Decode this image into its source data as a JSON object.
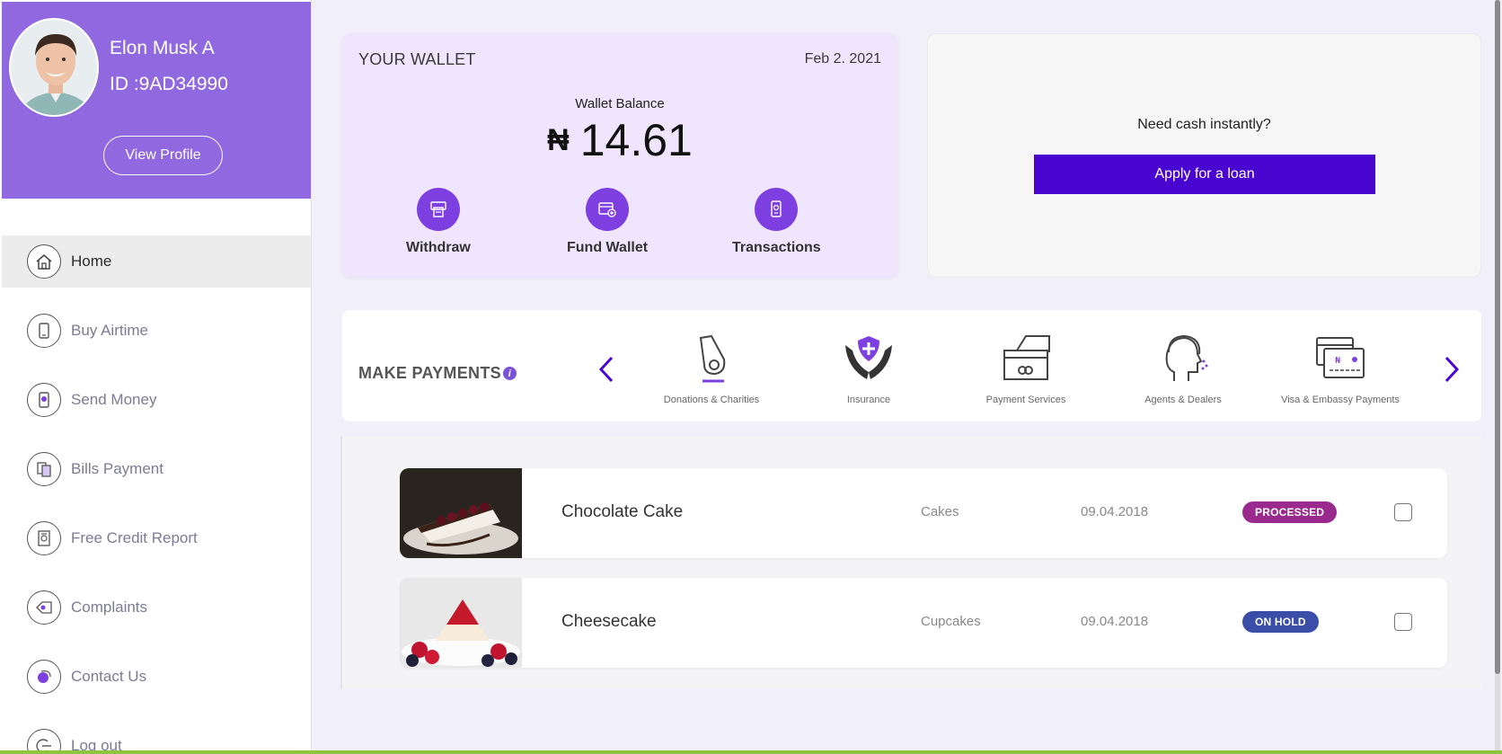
{
  "profile": {
    "name": "Elon Musk A",
    "id": "ID :9AD34990",
    "view_profile": "View Profile"
  },
  "nav": {
    "items": [
      {
        "label": "Home",
        "icon": "home-icon"
      },
      {
        "label": "Buy Airtime",
        "icon": "phone-icon"
      },
      {
        "label": "Send Money",
        "icon": "send-money-icon"
      },
      {
        "label": "Bills Payment",
        "icon": "bills-icon"
      },
      {
        "label": "Free Credit Report",
        "icon": "credit-report-icon"
      },
      {
        "label": "Complaints",
        "icon": "complaints-icon"
      },
      {
        "label": "Contact Us",
        "icon": "contact-icon"
      },
      {
        "label": "Log out",
        "icon": "logout-icon"
      }
    ]
  },
  "wallet": {
    "title": "YOUR WALLET",
    "date": "Feb 2. 2021",
    "balance_label": "Wallet Balance",
    "currency": "₦",
    "balance": "14.61",
    "actions": [
      {
        "label": "Withdraw",
        "icon": "withdraw-icon"
      },
      {
        "label": "Fund Wallet",
        "icon": "fund-wallet-icon"
      },
      {
        "label": "Transactions",
        "icon": "transactions-icon"
      }
    ]
  },
  "loan": {
    "text": "Need cash instantly?",
    "button": "Apply for a loan"
  },
  "payments": {
    "title": "MAKE PAYMENTS",
    "info": "i",
    "items": [
      {
        "label": "Donations & Charities",
        "icon": "donation-icon"
      },
      {
        "label": "Insurance",
        "icon": "insurance-icon"
      },
      {
        "label": "Payment Services",
        "icon": "payment-services-icon"
      },
      {
        "label": "Agents & Dealers",
        "icon": "agent-icon"
      },
      {
        "label": "Visa & Embassy Payments",
        "icon": "visa-icon"
      }
    ]
  },
  "products": [
    {
      "name": "Chocolate Cake",
      "category": "Cakes",
      "date": "09.04.2018",
      "status": "PROCESSED",
      "status_color": "#9b2a8e"
    },
    {
      "name": "Cheesecake",
      "category": "Cupcakes",
      "date": "09.04.2018",
      "status": "ON HOLD",
      "status_color": "#3a4ea8"
    }
  ],
  "colors": {
    "primary": "#4a06d1",
    "profile_bg": "#9068df",
    "wallet_bg": "#efe6fd",
    "accent": "#7e3fe0"
  }
}
